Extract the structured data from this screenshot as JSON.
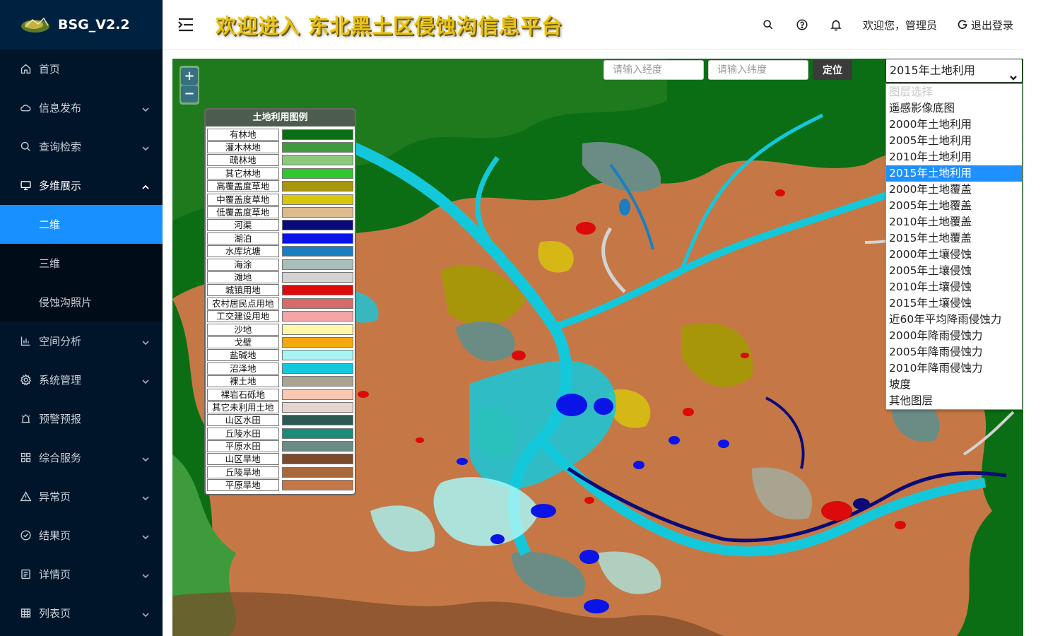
{
  "app": {
    "logo_text": "BSG_V2.2",
    "title": "欢迎进入 东北黑土区侵蚀沟信息平台"
  },
  "header": {
    "welcome": "欢迎您，管理员",
    "logout": "退出登录"
  },
  "sidebar": {
    "items": [
      {
        "label": "首页",
        "icon": "home-icon",
        "has_arrow": false
      },
      {
        "label": "信息发布",
        "icon": "cloud-icon",
        "has_arrow": true
      },
      {
        "label": "查询检索",
        "icon": "search-icon",
        "has_arrow": true
      },
      {
        "label": "多维展示",
        "icon": "monitor-icon",
        "has_arrow": true,
        "open": true
      },
      {
        "label": "空间分析",
        "icon": "bar-chart-icon",
        "has_arrow": true
      },
      {
        "label": "系统管理",
        "icon": "gear-icon",
        "has_arrow": true
      },
      {
        "label": "预警预报",
        "icon": "alarm-icon",
        "has_arrow": false
      },
      {
        "label": "综合服务",
        "icon": "grid-icon",
        "has_arrow": true
      },
      {
        "label": "异常页",
        "icon": "warning-icon",
        "has_arrow": true
      },
      {
        "label": "结果页",
        "icon": "check-circle-icon",
        "has_arrow": true
      },
      {
        "label": "详情页",
        "icon": "profile-icon",
        "has_arrow": true
      },
      {
        "label": "列表页",
        "icon": "table-icon",
        "has_arrow": true
      }
    ],
    "submenu": [
      {
        "label": "二维",
        "active": true
      },
      {
        "label": "三维",
        "active": false
      },
      {
        "label": "侵蚀沟照片",
        "active": false
      }
    ]
  },
  "map": {
    "zoom_in": "+",
    "zoom_out": "−",
    "lng_placeholder": "请输入经度",
    "lat_placeholder": "请输入纬度",
    "locate_label": "定位",
    "layer_selected": "2015年土地利用",
    "layer_options": [
      {
        "label": "图层选择",
        "disabled": true
      },
      {
        "label": "遥感影像底图"
      },
      {
        "label": "2000年土地利用"
      },
      {
        "label": "2005年土地利用"
      },
      {
        "label": "2010年土地利用"
      },
      {
        "label": "2015年土地利用",
        "selected": true
      },
      {
        "label": "2000年土地覆盖"
      },
      {
        "label": "2005年土地覆盖"
      },
      {
        "label": "2010年土地覆盖"
      },
      {
        "label": "2015年土地覆盖"
      },
      {
        "label": "2000年土壤侵蚀"
      },
      {
        "label": "2005年土壤侵蚀"
      },
      {
        "label": "2010年土壤侵蚀"
      },
      {
        "label": "2015年土壤侵蚀"
      },
      {
        "label": "近60年平均降雨侵蚀力"
      },
      {
        "label": "2000年降雨侵蚀力"
      },
      {
        "label": "2005年降雨侵蚀力"
      },
      {
        "label": "2010年降雨侵蚀力"
      },
      {
        "label": "坡度"
      },
      {
        "label": "其他图层"
      }
    ]
  },
  "legend": {
    "title": "土地利用图例",
    "items": [
      {
        "label": "有林地",
        "color": "#0b6e14"
      },
      {
        "label": "灌木林地",
        "color": "#3e9a3a"
      },
      {
        "label": "疏林地",
        "color": "#8cc97a"
      },
      {
        "label": "其它林地",
        "color": "#2ec82e"
      },
      {
        "label": "高覆盖度草地",
        "color": "#a8960a"
      },
      {
        "label": "中覆盖度草地",
        "color": "#d8c70a"
      },
      {
        "label": "低覆盖度草地",
        "color": "#dcbb8c"
      },
      {
        "label": "河渠",
        "color": "#0a0a78"
      },
      {
        "label": "湖泊",
        "color": "#0a14e6"
      },
      {
        "label": "水库坑塘",
        "color": "#1a7ec0"
      },
      {
        "label": "海涂",
        "color": "#a8bcb8"
      },
      {
        "label": "滩地",
        "color": "#d3d3d3"
      },
      {
        "label": "城镇用地",
        "color": "#dc0a0a"
      },
      {
        "label": "农村居民点用地",
        "color": "#d46a6a"
      },
      {
        "label": "工交建设用地",
        "color": "#f4a5a5"
      },
      {
        "label": "沙地",
        "color": "#fff6a8"
      },
      {
        "label": "戈壁",
        "color": "#f4a810"
      },
      {
        "label": "盐碱地",
        "color": "#a8f4f4"
      },
      {
        "label": "沼泽地",
        "color": "#14c8dc"
      },
      {
        "label": "裸土地",
        "color": "#a8a490"
      },
      {
        "label": "裸岩石砾地",
        "color": "#f8c8b0"
      },
      {
        "label": "其它未利用土地",
        "color": "#e6d4d0"
      },
      {
        "label": "山区水田",
        "color": "#2a5a52"
      },
      {
        "label": "丘陵水田",
        "color": "#1a8c7a"
      },
      {
        "label": "平原水田",
        "color": "#6a8c84"
      },
      {
        "label": "山区旱地",
        "color": "#7a4a2a"
      },
      {
        "label": "丘陵旱地",
        "color": "#a8693a"
      },
      {
        "label": "平原旱地",
        "color": "#c57845"
      }
    ]
  }
}
